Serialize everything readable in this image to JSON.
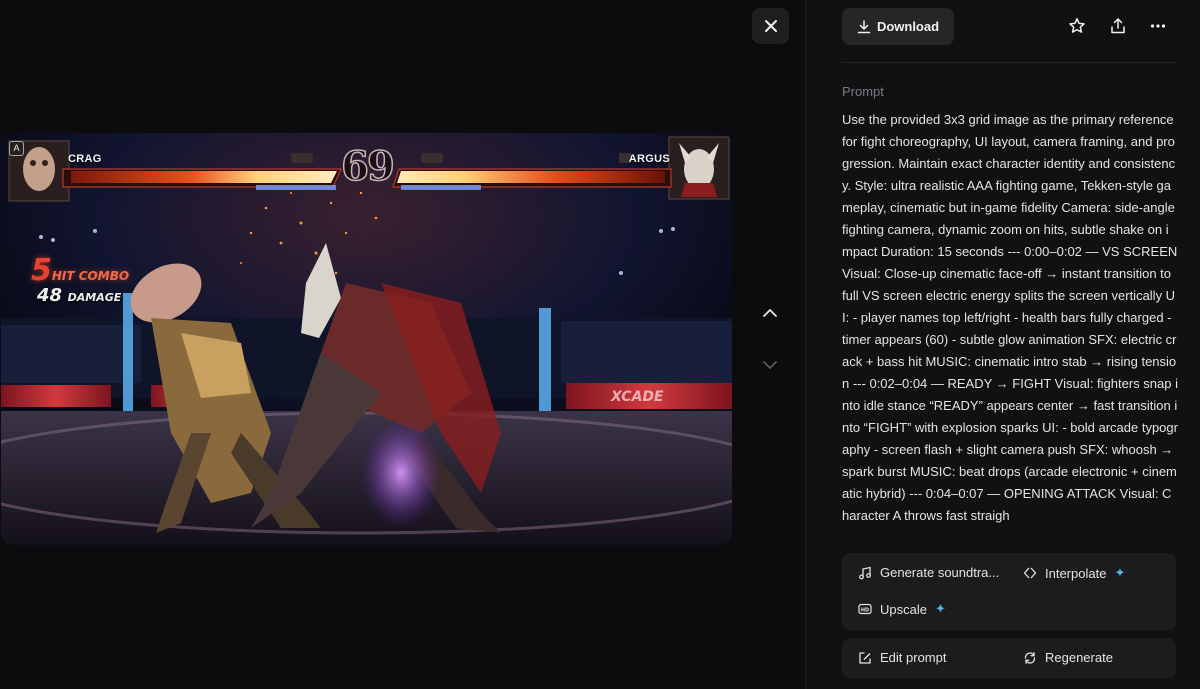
{
  "viewer": {
    "close_icon": "close-icon",
    "nav_up_icon": "chevron-up-icon",
    "nav_down_icon": "chevron-down-icon",
    "game": {
      "player_left": "CRAG",
      "player_right": "ARGUS",
      "timer": "69",
      "combo_count": "5",
      "combo_label": "HIT COMBO",
      "damage_value": "48",
      "damage_label": "DAMAGE",
      "badge": "A",
      "arena_banner": "XCADE"
    }
  },
  "panel": {
    "download_label": "Download",
    "download_icon": "download-icon",
    "star_icon": "star-icon",
    "share_icon": "share-icon",
    "more_icon": "more-horizontal-icon",
    "prompt_label": "Prompt",
    "prompt_text": "Use the provided 3x3 grid image as the primary reference for fight choreography, UI layout, camera framing, and progression. Maintain exact character identity and consistency. Style: ultra realistic AAA fighting game, Tekken-style gameplay, cinematic but in-game fidelity Camera: side-angle fighting camera, dynamic zoom on hits, subtle shake on impact Duration: 15 seconds --- 0:00–0:02 — VS SCREEN Visual: Close-up cinematic face-off → instant transition to full VS screen electric energy splits the screen vertically UI: - player names top left/right - health bars fully charged - timer appears (60) - subtle glow animation SFX: electric crack + bass hit MUSIC: cinematic intro stab → rising tension --- 0:02–0:04 — READY → FIGHT Visual: fighters snap into idle stance “READY” appears center → fast transition into “FIGHT” with explosion sparks UI: - bold arcade typography - screen flash + slight camera push SFX: whoosh → spark burst MUSIC: beat drops (arcade electronic + cinematic hybrid) --- 0:04–0:07 — OPENING ATTACK Visual: Character A throws fast straigh",
    "actions": {
      "generate_soundtrack": "Generate soundtra...",
      "interpolate": "Interpolate",
      "upscale": "Upscale",
      "edit_prompt": "Edit prompt",
      "regenerate": "Regenerate"
    },
    "colors": {
      "accent_sparkle": "#4fb7e8",
      "panel_bg": "#111113",
      "card_bg": "#1c1c1f"
    }
  }
}
